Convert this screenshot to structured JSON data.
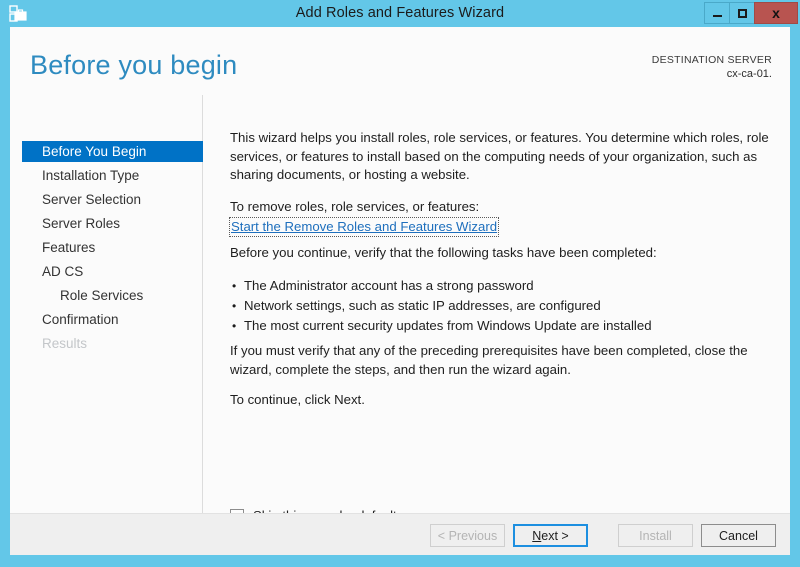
{
  "window": {
    "title": "Add Roles and Features Wizard",
    "icon": "server-roles-icon",
    "controls": {
      "minimize": "minimize-icon",
      "maximize": "maximize-icon",
      "close": "x"
    },
    "frame_color": "#63c7e8",
    "close_color": "#b85450"
  },
  "header": {
    "page_title": "Before you begin",
    "destination_label": "DESTINATION SERVER",
    "destination_value": "cx-ca-01.",
    "title_color": "#2e8bc0"
  },
  "nav": {
    "selected_color": "#0072c6",
    "items": [
      {
        "label": "Before You Begin",
        "state": "selected",
        "indent": false
      },
      {
        "label": "Installation Type",
        "state": "normal",
        "indent": false
      },
      {
        "label": "Server Selection",
        "state": "normal",
        "indent": false
      },
      {
        "label": "Server Roles",
        "state": "normal",
        "indent": false
      },
      {
        "label": "Features",
        "state": "normal",
        "indent": false
      },
      {
        "label": "AD CS",
        "state": "normal",
        "indent": false
      },
      {
        "label": "Role Services",
        "state": "normal",
        "indent": true
      },
      {
        "label": "Confirmation",
        "state": "normal",
        "indent": false
      },
      {
        "label": "Results",
        "state": "disabled",
        "indent": false
      }
    ]
  },
  "content": {
    "intro_paragraph": "This wizard helps you install roles, role services, or features. You determine which roles, role services, or features to install based on the computing needs of your organization, such as sharing documents, or hosting a website.",
    "remove_label": "To remove roles, role services, or features:",
    "remove_link": "Start the Remove Roles and Features Wizard",
    "link_color": "#1e6fbd",
    "verify_label": "Before you continue, verify that the following tasks have been completed:",
    "bullets": [
      "The Administrator account has a strong password",
      "Network settings, such as static IP addresses, are configured",
      "The most current security updates from Windows Update are installed"
    ],
    "prereq_paragraph": "If you must verify that any of the preceding prerequisites have been completed, close the wizard, complete the steps, and then run the wizard again.",
    "continue_paragraph": "To continue, click Next."
  },
  "skip": {
    "label": "Skip this page by default",
    "accelerator": "S",
    "rest": "kip this page by default",
    "checked": false
  },
  "footer": {
    "buttons": [
      {
        "label": "< Previous",
        "state": "disabled"
      },
      {
        "label": "Next >",
        "state": "focused"
      },
      {
        "label": "Install",
        "state": "disabled"
      },
      {
        "label": "Cancel",
        "state": "normal"
      }
    ],
    "previous_label": "< Previous",
    "next_prefix": "N",
    "next_suffix": "ext >",
    "install_label": "Install",
    "cancel_label": "Cancel",
    "background": "#efefef"
  }
}
